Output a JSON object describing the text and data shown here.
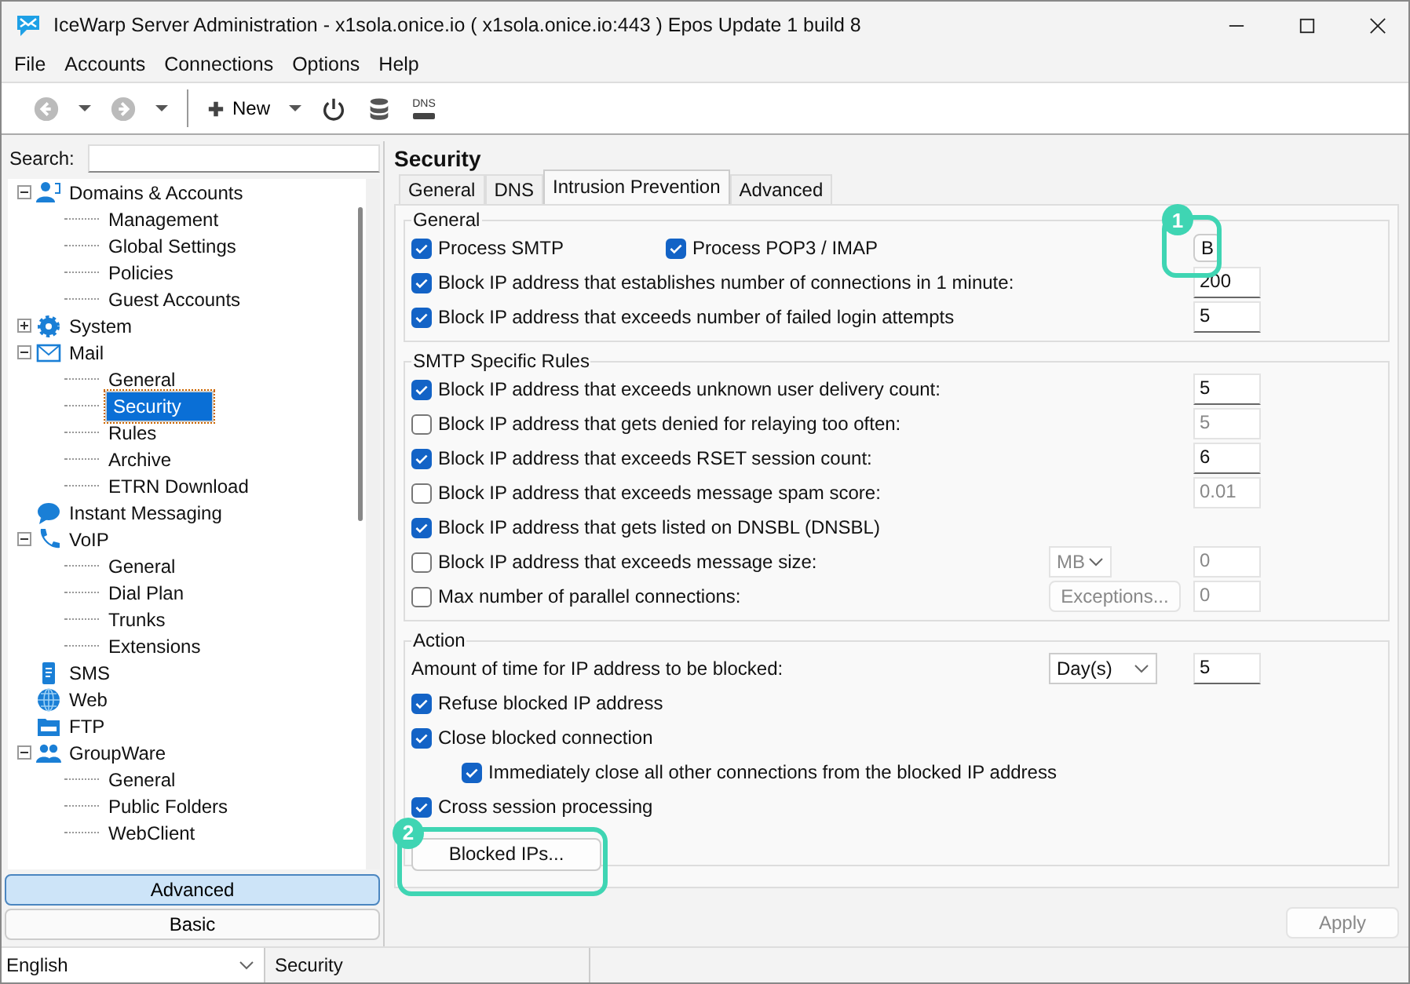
{
  "window": {
    "title": "IceWarp Server Administration - x1sola.onice.io ( x1sola.onice.io:443 ) Epos Update 1 build 8"
  },
  "menu": [
    "File",
    "Accounts",
    "Connections",
    "Options",
    "Help"
  ],
  "toolbar": [
    {
      "kind": "back",
      "disabled": true
    },
    {
      "kind": "dropdown"
    },
    {
      "kind": "forward",
      "disabled": true
    },
    {
      "kind": "dropdown"
    },
    {
      "kind": "separator"
    },
    {
      "kind": "new",
      "label": "New"
    },
    {
      "kind": "dropdown"
    },
    {
      "kind": "power"
    },
    {
      "kind": "database"
    },
    {
      "kind": "dns",
      "label": "DNS"
    }
  ],
  "search": {
    "label": "Search:"
  },
  "tree": [
    {
      "label": "Domains & Accounts",
      "kind": "people",
      "expanded": true,
      "children": [
        {
          "label": "Management",
          "selected": false
        },
        {
          "label": "Global Settings",
          "selected": false
        },
        {
          "label": "Policies",
          "selected": false
        },
        {
          "label": "Guest Accounts",
          "selected": false
        }
      ]
    },
    {
      "label": "System",
      "kind": "gear",
      "expanded": false
    },
    {
      "label": "Mail",
      "kind": "mail",
      "expanded": true,
      "children": [
        {
          "label": "General",
          "selected": false
        },
        {
          "label": "Security",
          "selected": true
        },
        {
          "label": "Rules",
          "selected": false
        },
        {
          "label": "Archive",
          "selected": false
        },
        {
          "label": "ETRN Download",
          "selected": false
        }
      ]
    },
    {
      "label": "Instant Messaging",
      "kind": "chat"
    },
    {
      "label": "VoIP",
      "kind": "phone",
      "expanded": true,
      "children": [
        {
          "label": "General",
          "selected": false
        },
        {
          "label": "Dial Plan",
          "selected": false
        },
        {
          "label": "Trunks",
          "selected": false
        },
        {
          "label": "Extensions",
          "selected": false
        }
      ]
    },
    {
      "label": "SMS",
      "kind": "sms"
    },
    {
      "label": "Web",
      "kind": "globe"
    },
    {
      "label": "FTP",
      "kind": "ftp"
    },
    {
      "label": "GroupWare",
      "kind": "group",
      "expanded": true,
      "children": [
        {
          "label": "General",
          "selected": false
        },
        {
          "label": "Public Folders",
          "selected": false
        },
        {
          "label": "WebClient",
          "selected": false
        }
      ]
    }
  ],
  "modes": [
    {
      "label": "Advanced",
      "selected": true
    },
    {
      "label": "Basic",
      "selected": false
    }
  ],
  "status_bar": {
    "language": "English",
    "section": "Security"
  },
  "page": {
    "title": "Security",
    "tabs": [
      {
        "label": "General",
        "selected": false
      },
      {
        "label": "DNS",
        "selected": false
      },
      {
        "label": "Intrusion Prevention",
        "selected": true
      },
      {
        "label": "Advanced",
        "selected": false
      }
    ],
    "groups": [
      {
        "title": "General",
        "rows": [
          {
            "kind": "pair",
            "checks": [
              {
                "label": "Process SMTP",
                "checked": true
              },
              {
                "label": "Process POP3 / IMAP",
                "checked": true
              }
            ],
            "button": {
              "label": "B",
              "disabled": false,
              "callout": "1"
            }
          },
          {
            "kind": "check",
            "label": "Block IP address that establishes number of connections in 1 minute:",
            "checked": true,
            "field": {
              "value": "200",
              "disabled": false
            }
          },
          {
            "kind": "check",
            "label": "Block IP address that exceeds number of failed login attempts",
            "checked": true,
            "field": {
              "value": "5",
              "disabled": false
            }
          }
        ]
      },
      {
        "title": "SMTP Specific Rules",
        "rows": [
          {
            "kind": "check",
            "label": "Block IP address that exceeds unknown user delivery count:",
            "checked": true,
            "field": {
              "value": "5",
              "disabled": false
            }
          },
          {
            "kind": "check",
            "label": "Block IP address that gets denied for relaying too often:",
            "checked": false,
            "field": {
              "value": "5",
              "disabled": true
            }
          },
          {
            "kind": "check",
            "label": "Block IP address that exceeds RSET session count:",
            "checked": true,
            "field": {
              "value": "6",
              "disabled": false
            }
          },
          {
            "kind": "check",
            "label": "Block IP address that exceeds message spam score:",
            "checked": false,
            "field": {
              "value": "0.01",
              "disabled": true
            }
          },
          {
            "kind": "check",
            "label": "Block IP address that gets listed on DNSBL (DNSBL)",
            "checked": true
          },
          {
            "kind": "check",
            "label": "Block IP address that exceeds message size:",
            "checked": false,
            "select": {
              "value": "MB",
              "disabled": true
            },
            "field": {
              "value": "0",
              "disabled": true
            }
          },
          {
            "kind": "check",
            "label": "Max number of parallel connections:",
            "checked": false,
            "button": {
              "label": "Exceptions...",
              "disabled": true
            },
            "field": {
              "value": "0",
              "disabled": true
            }
          }
        ]
      },
      {
        "title": "Action",
        "rows": [
          {
            "kind": "text",
            "label": "Amount of time for IP address to be blocked:",
            "select": {
              "value": "Day(s)",
              "disabled": false
            },
            "field": {
              "value": "5",
              "disabled": false
            }
          },
          {
            "kind": "check",
            "label": "Refuse blocked IP address",
            "checked": true
          },
          {
            "kind": "check",
            "label": "Close blocked connection",
            "checked": true,
            "children": [
              {
                "label": "Immediately close all other connections from the blocked IP address",
                "checked": true
              }
            ]
          },
          {
            "kind": "check",
            "label": "Cross session processing",
            "checked": true
          },
          {
            "kind": "action",
            "button": {
              "label": "Blocked IPs...",
              "disabled": false,
              "callout": "2"
            }
          }
        ]
      }
    ]
  },
  "apply": {
    "label": "Apply",
    "disabled": true
  }
}
